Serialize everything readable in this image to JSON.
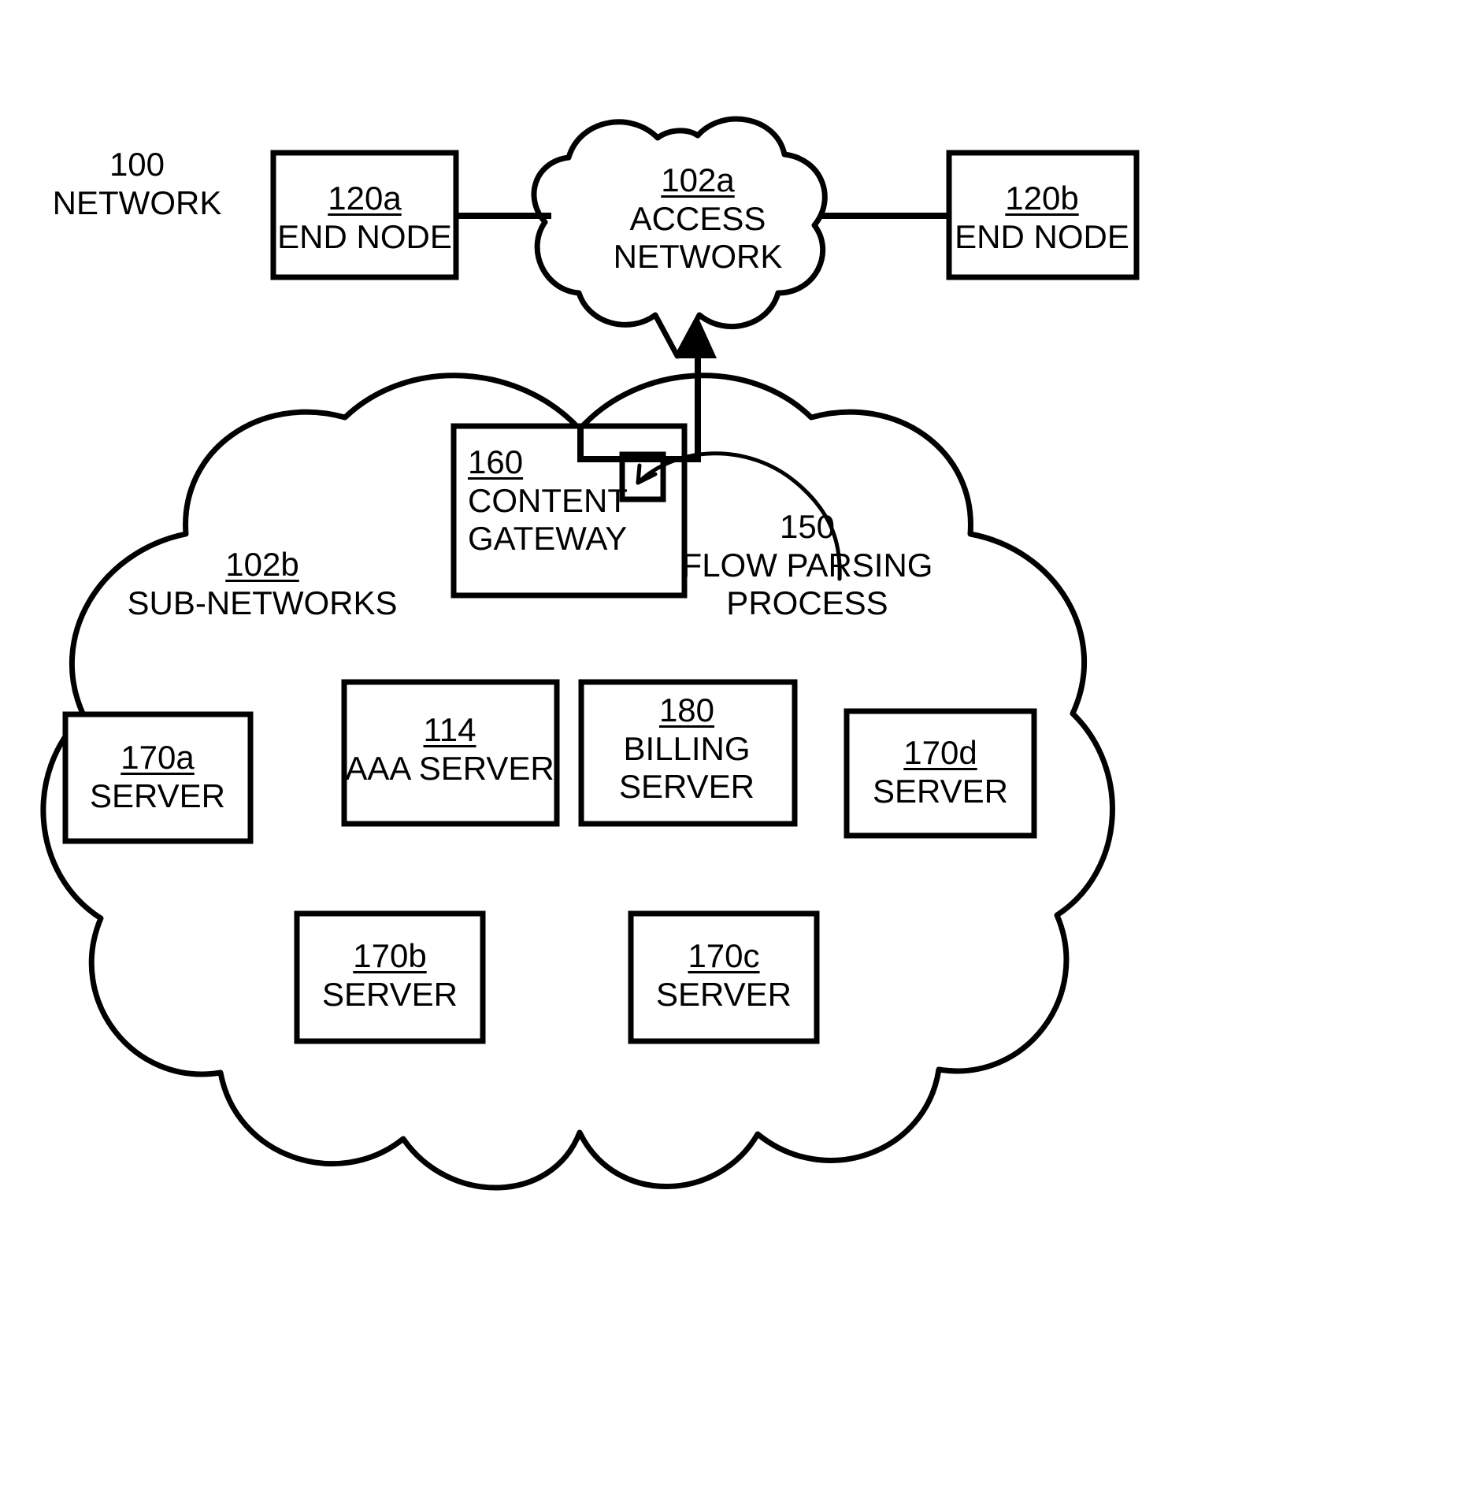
{
  "figure": {
    "type": "patent-network-diagram",
    "background_color": "#ffffff",
    "line_color": "#000000"
  },
  "labels": {
    "network": {
      "ref": "100",
      "underlined": false,
      "name": "NETWORK"
    },
    "access_network": {
      "ref": "102a",
      "underlined": true,
      "line1": "ACCESS",
      "line2": "NETWORK"
    },
    "sub_networks": {
      "ref": "102b",
      "underlined": true,
      "name": "SUB-NETWORKS"
    },
    "flow_parsing": {
      "ref": "150",
      "underlined": false,
      "line1": "FLOW PARSING",
      "line2": "PROCESS"
    }
  },
  "nodes": {
    "end_node_a": {
      "ref": "120a",
      "underlined": true,
      "name": "END NODE"
    },
    "end_node_b": {
      "ref": "120b",
      "underlined": true,
      "name": "END NODE"
    },
    "content_gateway": {
      "ref": "160",
      "underlined": true,
      "line1": "CONTENT",
      "line2": "GATEWAY"
    },
    "aaa_server": {
      "ref": "114",
      "underlined": true,
      "name": "AAA SERVER"
    },
    "billing_server": {
      "ref": "180",
      "underlined": true,
      "line1": "BILLING",
      "line2": "SERVER"
    },
    "server_a": {
      "ref": "170a",
      "underlined": true,
      "name": "SERVER"
    },
    "server_b": {
      "ref": "170b",
      "underlined": true,
      "name": "SERVER"
    },
    "server_c": {
      "ref": "170c",
      "underlined": true,
      "name": "SERVER"
    },
    "server_d": {
      "ref": "170d",
      "underlined": true,
      "name": "SERVER"
    }
  }
}
